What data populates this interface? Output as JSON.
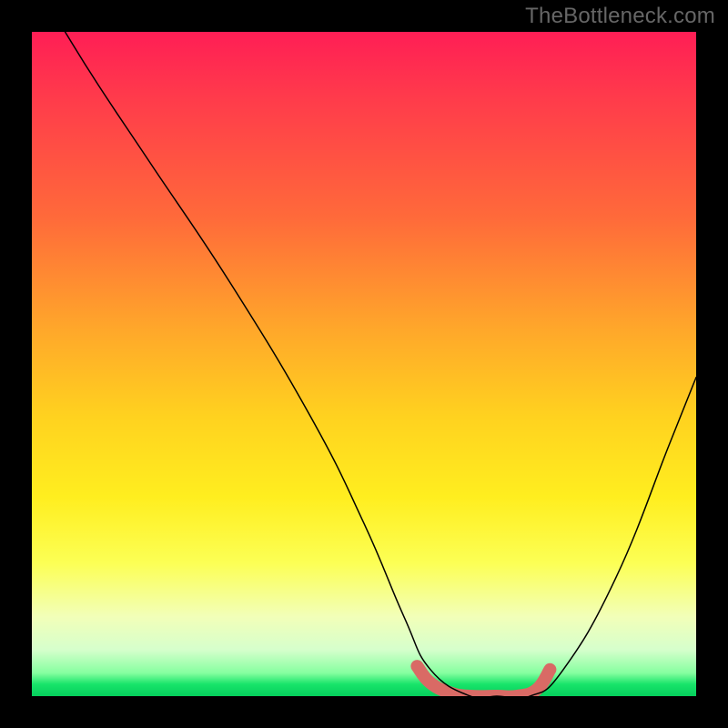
{
  "watermark": "TheBottleneck.com",
  "chart_data": {
    "type": "line",
    "title": "",
    "xlabel": "",
    "ylabel": "",
    "xlim": [
      0,
      100
    ],
    "ylim": [
      0,
      100
    ],
    "background_gradient": {
      "top_color": "#ff1e55",
      "mid_color": "#ffd21f",
      "bottom_color": "#05cf5c",
      "meaning": "bottleneck severity (red high, green low)"
    },
    "series": [
      {
        "name": "bottleneck-curve",
        "stroke": "#000000",
        "stroke_width": 1.5,
        "x": [
          5,
          10,
          18,
          30,
          42,
          50,
          56,
          60,
          66,
          70,
          75,
          80,
          88,
          96,
          100
        ],
        "values": [
          100,
          92,
          80,
          62,
          42,
          26,
          12,
          4,
          0,
          0,
          0,
          4,
          18,
          38,
          48
        ]
      }
    ],
    "highlight": {
      "name": "optimal-range",
      "stroke": "#d96a65",
      "stroke_width": 14,
      "x": [
        58,
        60,
        63,
        66,
        70,
        73,
        76,
        78
      ],
      "values": [
        4.5,
        2,
        0.5,
        0,
        0,
        0,
        1,
        4
      ]
    }
  }
}
